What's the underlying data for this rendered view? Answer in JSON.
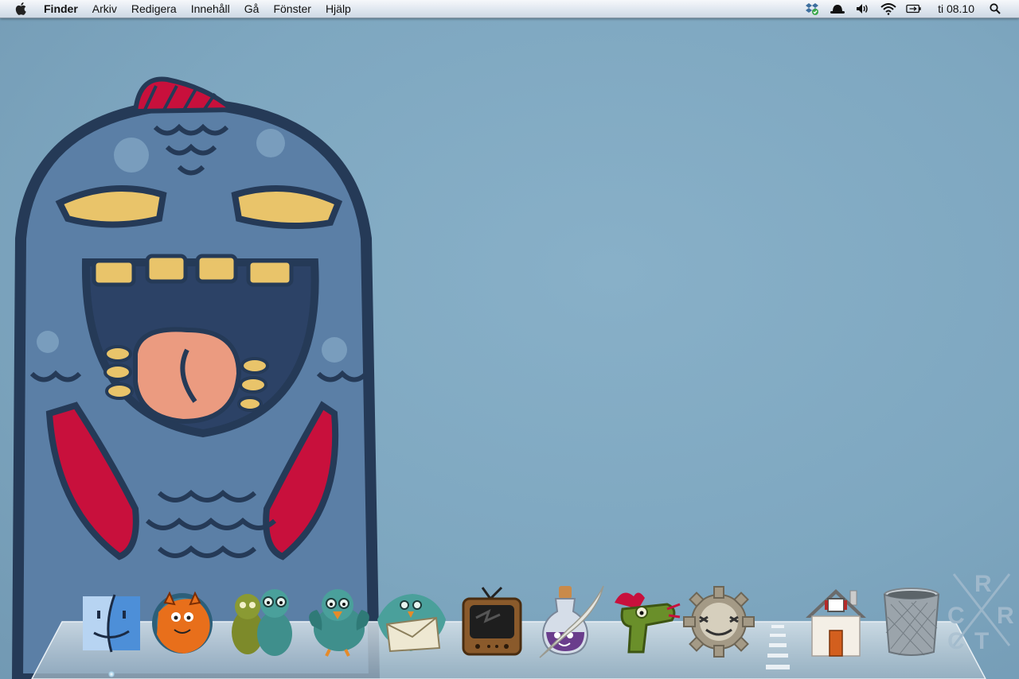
{
  "menubar": {
    "app_name": "Finder",
    "menus": [
      "Arkiv",
      "Redigera",
      "Innehåll",
      "Gå",
      "Fönster",
      "Hjälp"
    ],
    "clock": "ti 08.10",
    "status_icons": [
      "dropbox-icon",
      "growl-icon",
      "volume-icon",
      "wifi-icon",
      "battery-icon"
    ]
  },
  "dock": {
    "items": [
      {
        "name": "finder",
        "icon": "finder-icon",
        "running": true
      },
      {
        "name": "firefox",
        "icon": "firefox-icon"
      },
      {
        "name": "adium",
        "icon": "zombie-duo-icon"
      },
      {
        "name": "twitter",
        "icon": "bird-icon"
      },
      {
        "name": "mail",
        "icon": "bird-mail-icon"
      },
      {
        "name": "tv",
        "icon": "tv-icon"
      },
      {
        "name": "textedit",
        "icon": "ink-quill-icon"
      },
      {
        "name": "raygun",
        "icon": "ray-gun-icon"
      },
      {
        "name": "preferences",
        "icon": "gear-icon"
      },
      {
        "name": "home",
        "icon": "house-icon"
      },
      {
        "name": "trash",
        "icon": "trash-icon"
      }
    ]
  },
  "watermark": {
    "letters": [
      "R",
      "C",
      "R",
      "T",
      "C"
    ]
  },
  "colors": {
    "desktop": "#7fa6bf",
    "monster_blue": "#5b7fa6",
    "monster_outline": "#253a57",
    "feather_red": "#c8103c"
  }
}
